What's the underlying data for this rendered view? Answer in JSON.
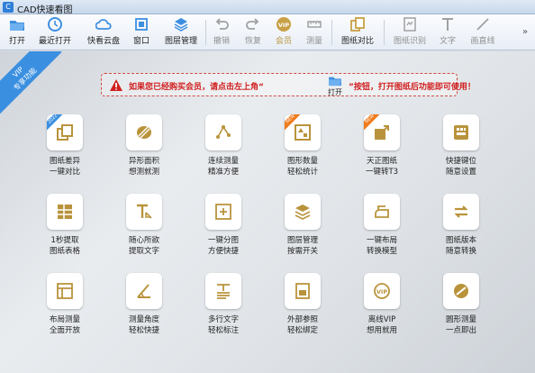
{
  "window": {
    "title": "CAD快速看图"
  },
  "toolbar": {
    "items": [
      {
        "label": "打开",
        "icon": "folder-open-icon",
        "enabled": true
      },
      {
        "label": "最近打开",
        "icon": "clock-icon",
        "enabled": true
      },
      {
        "label": "快看云盘",
        "icon": "cloud-icon",
        "enabled": true
      },
      {
        "label": "窗口",
        "icon": "window-icon",
        "enabled": true
      },
      {
        "label": "图层管理",
        "icon": "layers-icon",
        "enabled": true
      },
      {
        "label": "撤销",
        "icon": "undo-icon",
        "enabled": false
      },
      {
        "label": "恢复",
        "icon": "redo-icon",
        "enabled": false
      },
      {
        "label": "会员",
        "icon": "vip-icon",
        "enabled": true
      },
      {
        "label": "测量",
        "icon": "ruler-icon",
        "enabled": false
      },
      {
        "label": "图纸对比",
        "icon": "compare-icon",
        "enabled": true
      },
      {
        "label": "图纸识别",
        "icon": "recognize-icon",
        "enabled": false
      },
      {
        "label": "文字",
        "icon": "text-icon",
        "enabled": false
      },
      {
        "label": "画直线",
        "icon": "line-icon",
        "enabled": false
      }
    ],
    "more": "»"
  },
  "vip_ribbon": {
    "line1": "VIP",
    "line2": "专享功能"
  },
  "notice": {
    "text_before": "如果您已经购买会员，请点击左上角“",
    "open_label": "打开",
    "text_after": "”按钮，打开图纸后功能即可使用！"
  },
  "features": [
    {
      "line1": "图纸差异",
      "line2": "一键对比",
      "icon": "compare-icon",
      "badge": "2022"
    },
    {
      "line1": "异形面积",
      "line2": "想测就测",
      "icon": "area-icon",
      "badge": ""
    },
    {
      "line1": "连续测量",
      "line2": "精准方便",
      "icon": "continuous-measure-icon",
      "badge": ""
    },
    {
      "line1": "图形数量",
      "line2": "轻松统计",
      "icon": "count-icon",
      "badge": "NEW"
    },
    {
      "line1": "天正图纸",
      "line2": "一键转T3",
      "icon": "export-icon",
      "badge": "NEW"
    },
    {
      "line1": "快捷键位",
      "line2": "随意设置",
      "icon": "keyboard-icon",
      "badge": ""
    },
    {
      "line1": "1秒提取",
      "line2": "图纸表格",
      "icon": "table-extract-icon",
      "badge": ""
    },
    {
      "line1": "随心所欲",
      "line2": "提取文字",
      "icon": "text-extract-icon",
      "badge": ""
    },
    {
      "line1": "一键分图",
      "line2": "方便快捷",
      "icon": "split-drawing-icon",
      "badge": ""
    },
    {
      "line1": "图层管理",
      "line2": "按需开关",
      "icon": "layers-icon",
      "badge": ""
    },
    {
      "line1": "一键布局",
      "line2": "转换模型",
      "icon": "layout-convert-icon",
      "badge": ""
    },
    {
      "line1": "图纸版本",
      "line2": "随意转换",
      "icon": "version-convert-icon",
      "badge": ""
    },
    {
      "line1": "布局测量",
      "line2": "全面开放",
      "icon": "layout-measure-icon",
      "badge": ""
    },
    {
      "line1": "测量角度",
      "line2": "轻松快捷",
      "icon": "angle-icon",
      "badge": ""
    },
    {
      "line1": "多行文字",
      "line2": "轻松标注",
      "icon": "multiline-text-icon",
      "badge": ""
    },
    {
      "line1": "外部参照",
      "line2": "轻松绑定",
      "icon": "xref-icon",
      "badge": ""
    },
    {
      "line1": "离线VIP",
      "line2": "想用就用",
      "icon": "vip-icon",
      "badge": ""
    },
    {
      "line1": "圆形测量",
      "line2": "一点即出",
      "icon": "circle-measure-icon",
      "badge": ""
    }
  ],
  "colors": {
    "accent": "#c8a046",
    "icon_gold": "#b9933c",
    "notice_red": "#d11f1f",
    "vip_blue": "#3a8fe0"
  }
}
